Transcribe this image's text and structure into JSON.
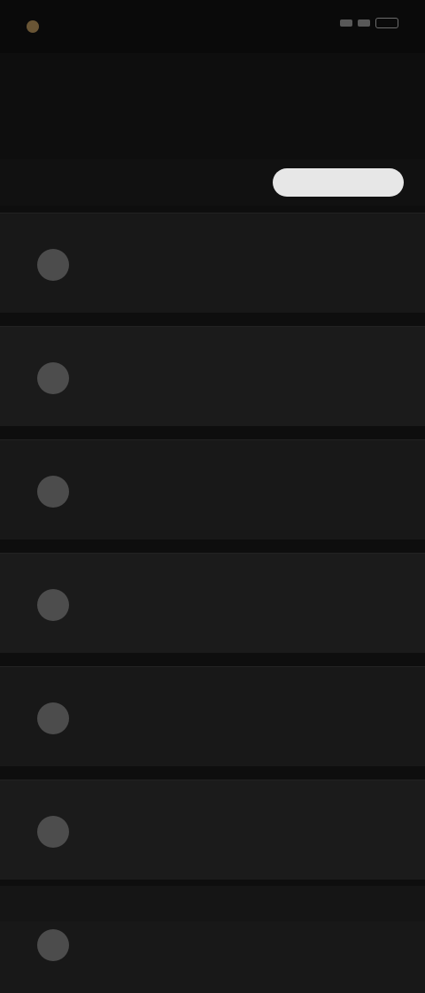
{
  "status": {
    "time": "",
    "app_name": ""
  },
  "header": {
    "title": "",
    "subtitle": ""
  },
  "filters": {
    "left_label": "",
    "middle_label": "",
    "action_label": ""
  },
  "list": {
    "items": [
      {
        "title": "",
        "subtitle": "",
        "meta": ""
      },
      {
        "title": "",
        "subtitle": "",
        "meta": ""
      },
      {
        "title": "",
        "subtitle": "",
        "meta": ""
      },
      {
        "title": "",
        "subtitle": "",
        "meta": ""
      },
      {
        "title": "",
        "subtitle": "",
        "meta": ""
      },
      {
        "title": "",
        "subtitle": "",
        "meta": ""
      },
      {
        "title": "",
        "subtitle": "",
        "meta": ""
      }
    ]
  }
}
